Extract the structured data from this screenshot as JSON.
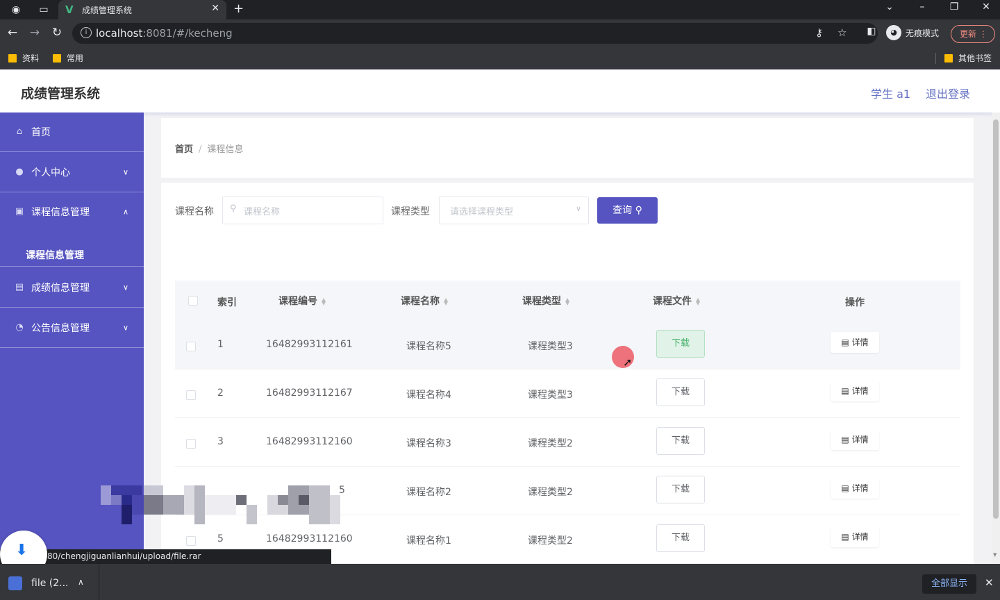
{
  "browser": {
    "tab_title": "成绩管理系统",
    "url_host": "localhost",
    "url_rest": ":8081/#/kecheng",
    "profile_label": "无痕模式",
    "update_label": "更新",
    "bookmarks": [
      "资料",
      "常用"
    ],
    "other_bookmarks": "其他书签"
  },
  "header": {
    "title": "成绩管理系统",
    "user": "学生 a1",
    "logout": "退出登录"
  },
  "sidebar": {
    "items": [
      {
        "label": "首页",
        "icon": "home-icon"
      },
      {
        "label": "个人中心",
        "icon": "user-icon"
      },
      {
        "label": "课程信息管理",
        "icon": "course-icon"
      },
      {
        "label": "成绩信息管理",
        "icon": "grade-icon"
      },
      {
        "label": "公告信息管理",
        "icon": "notice-icon"
      }
    ],
    "submenu": "课程信息管理"
  },
  "breadcrumb": {
    "home": "首页",
    "current": "课程信息"
  },
  "filters": {
    "name_label": "课程名称",
    "name_placeholder": "课程名称",
    "type_label": "课程类型",
    "type_placeholder": "请选择课程类型",
    "query_label": "查询"
  },
  "table": {
    "headers": [
      "索引",
      "课程编号",
      "课程名称",
      "课程类型",
      "课程文件",
      "操作"
    ],
    "download_label": "下载",
    "detail_label": "详情",
    "rows": [
      {
        "index": "1",
        "code": "16482993112161",
        "name": "课程名称5",
        "type": "课程类型3"
      },
      {
        "index": "2",
        "code": "16482993112167",
        "name": "课程名称4",
        "type": "课程类型3"
      },
      {
        "index": "3",
        "code": "16482993112160",
        "name": "课程名称3",
        "type": "课程类型2"
      },
      {
        "index": "",
        "code": "5",
        "name": "课程名称2",
        "type": "课程类型2"
      },
      {
        "index": "5",
        "code": "16482993112160",
        "name": "课程名称1",
        "type": "课程类型2"
      }
    ]
  },
  "status_bar": {
    "url": "80/chengjiguanlianhui/upload/file.rar"
  },
  "downloads": {
    "file": "file (2...",
    "show_all": "全部显示"
  },
  "colors": {
    "sidebar": "#5654c0",
    "accent": "#5654c0",
    "link": "#6673c4",
    "download_active": "#e1f3e8"
  }
}
